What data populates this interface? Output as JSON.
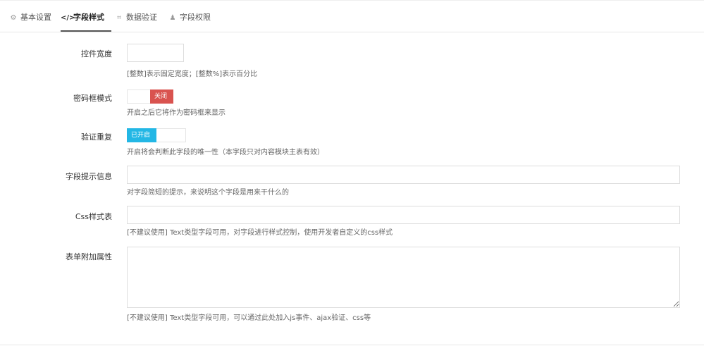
{
  "tabs": [
    {
      "icon": "gear-icon",
      "glyph": "⚙",
      "label": "基本设置"
    },
    {
      "icon": "code-icon",
      "glyph": "</>",
      "label": "字段样式"
    },
    {
      "icon": "crop-icon",
      "glyph": "⌗",
      "label": "数据验证"
    },
    {
      "icon": "user-icon",
      "glyph": "♟",
      "label": "字段权限"
    }
  ],
  "fields": {
    "width": {
      "label": "控件宽度",
      "value": "",
      "help": "[整数]表示固定宽度；[整数%]表示百分比"
    },
    "password_mode": {
      "label": "密码框模式",
      "switch_state": "关闭",
      "help": "开启之后它将作为密码框来显示"
    },
    "unique_check": {
      "label": "验证重复",
      "switch_state": "已开启",
      "help": "开启将会判断此字段的唯一性（本字段只对内容模块主表有效）"
    },
    "tips": {
      "label": "字段提示信息",
      "value": "",
      "help": "对字段简短的提示，来说明这个字段是用来干什么的"
    },
    "css": {
      "label": "Css样式表",
      "value": "",
      "help": "[不建议使用] Text类型字段可用，对字段进行样式控制，使用开发者自定义的css样式"
    },
    "attrs": {
      "label": "表单附加属性",
      "value": "",
      "help": "[不建议使用] Text类型字段可用，可以通过此处加入js事件、ajax验证、css等"
    }
  },
  "colors": {
    "switch_off": "#d9534f",
    "switch_on": "#23b7e5"
  }
}
